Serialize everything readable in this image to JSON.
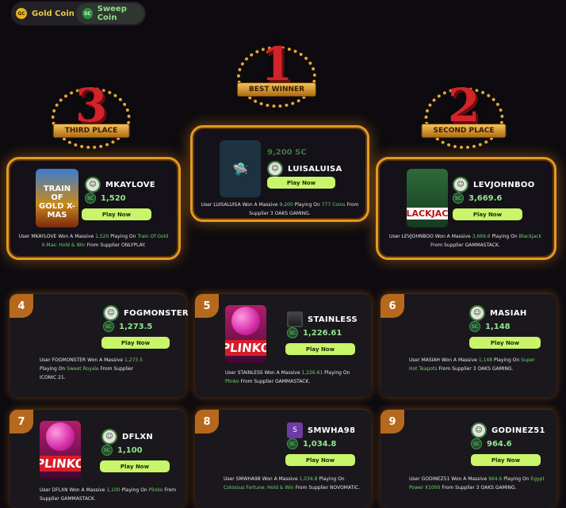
{
  "currency_toggle": {
    "gold_label": "Gold Coin",
    "gold_icon_text": "GC",
    "sweep_label": "Sweep Coin",
    "sweep_icon_text": "SC",
    "selected": "Sweep Coin"
  },
  "podium": {
    "first": {
      "rank": "1",
      "ribbon": "BEST WINNER",
      "username": "LUISALUISA",
      "amount": "9,200 SC",
      "play_label": "Play Now",
      "desc": {
        "pre": "User LUISALUISA Won A Massive ",
        "amount": "9,200",
        "mid": " Playing On ",
        "game": "777 Coins",
        "post": " From Supplier 3 OAKS GAMING."
      }
    },
    "second": {
      "rank": "2",
      "ribbon": "SECOND PLACE",
      "username": "LEVJOHNBOO",
      "amount": "3,669.6",
      "thumb_label": "BLACKJACK",
      "play_label": "Play Now",
      "desc": {
        "pre": "User LEVJOHNBOO Won A Massive ",
        "amount": "3,669.6",
        "mid": " Playing On ",
        "game": "Blackjack",
        "post": " From Supplier GAMMASTACK."
      }
    },
    "third": {
      "rank": "3",
      "ribbon": "THIRD PLACE",
      "username": "MKAYLOVE",
      "amount": "1,520",
      "thumb_label": "TRAIN OF GOLD X-MAS",
      "play_label": "Play Now",
      "desc": {
        "pre": "User MKAYLOVE Won A Massive ",
        "amount": "1,520",
        "mid": " Playing On ",
        "game": "Train Of Gold X-Mas: Hold & Win",
        "post": " From Supplier ONLYPLAY."
      }
    }
  },
  "cards": [
    {
      "rank": "4",
      "username": "FOGMONSTER",
      "amount": "1,273.5",
      "play_label": "Play Now",
      "desc": {
        "pre": "User FOGMONSTER Won A Massive ",
        "amount": "1,273.5",
        "mid": " Playing On ",
        "game": "Sweet Royale",
        "post": " From Supplier ICONIC 21."
      }
    },
    {
      "rank": "5",
      "username": "STAINLESS",
      "amount": "1,226.61",
      "thumb_label": "PLINKO",
      "play_label": "Play Now",
      "desc": {
        "pre": "User STAINLESS Won A Massive ",
        "amount": "1,226.61",
        "mid": " Playing On ",
        "game": "Plinko",
        "post": " From Supplier GAMMASTACK."
      }
    },
    {
      "rank": "6",
      "username": "MASIAH",
      "amount": "1,148",
      "play_label": "Play Now",
      "desc": {
        "pre": "User MASIAH Won A Massive ",
        "amount": "1,148",
        "mid": " Playing On ",
        "game": "Super Hot Teapots",
        "post": " From Supplier 3 OAKS GAMING."
      }
    },
    {
      "rank": "7",
      "username": "DFLXN",
      "amount": "1,100",
      "thumb_label": "PLINKO",
      "play_label": "Play Now",
      "desc": {
        "pre": "User DFLXN Won A Massive ",
        "amount": "1,100",
        "mid": " Playing On ",
        "game": "Plinko",
        "post": " From Supplier GAMMASTACK."
      }
    },
    {
      "rank": "8",
      "username": "SMWHA98",
      "avatar_letter": "S",
      "amount": "1,034.8",
      "play_label": "Play Now",
      "desc": {
        "pre": "User SMWHA98 Won A Massive ",
        "amount": "1,034.8",
        "mid": " Playing On ",
        "game": "Colossus Fortune: Hold & Win",
        "post": " From Supplier NOVOMATIC."
      }
    },
    {
      "rank": "9",
      "username": "GODINEZ51",
      "amount": "964.6",
      "play_label": "Play Now",
      "desc": {
        "pre": "User GODINEZ51 Won A Massive ",
        "amount": "964.6",
        "mid": " Playing On ",
        "game": "Egypt Power X1000",
        "post": " From Supplier 3 OAKS GAMING."
      }
    }
  ]
}
